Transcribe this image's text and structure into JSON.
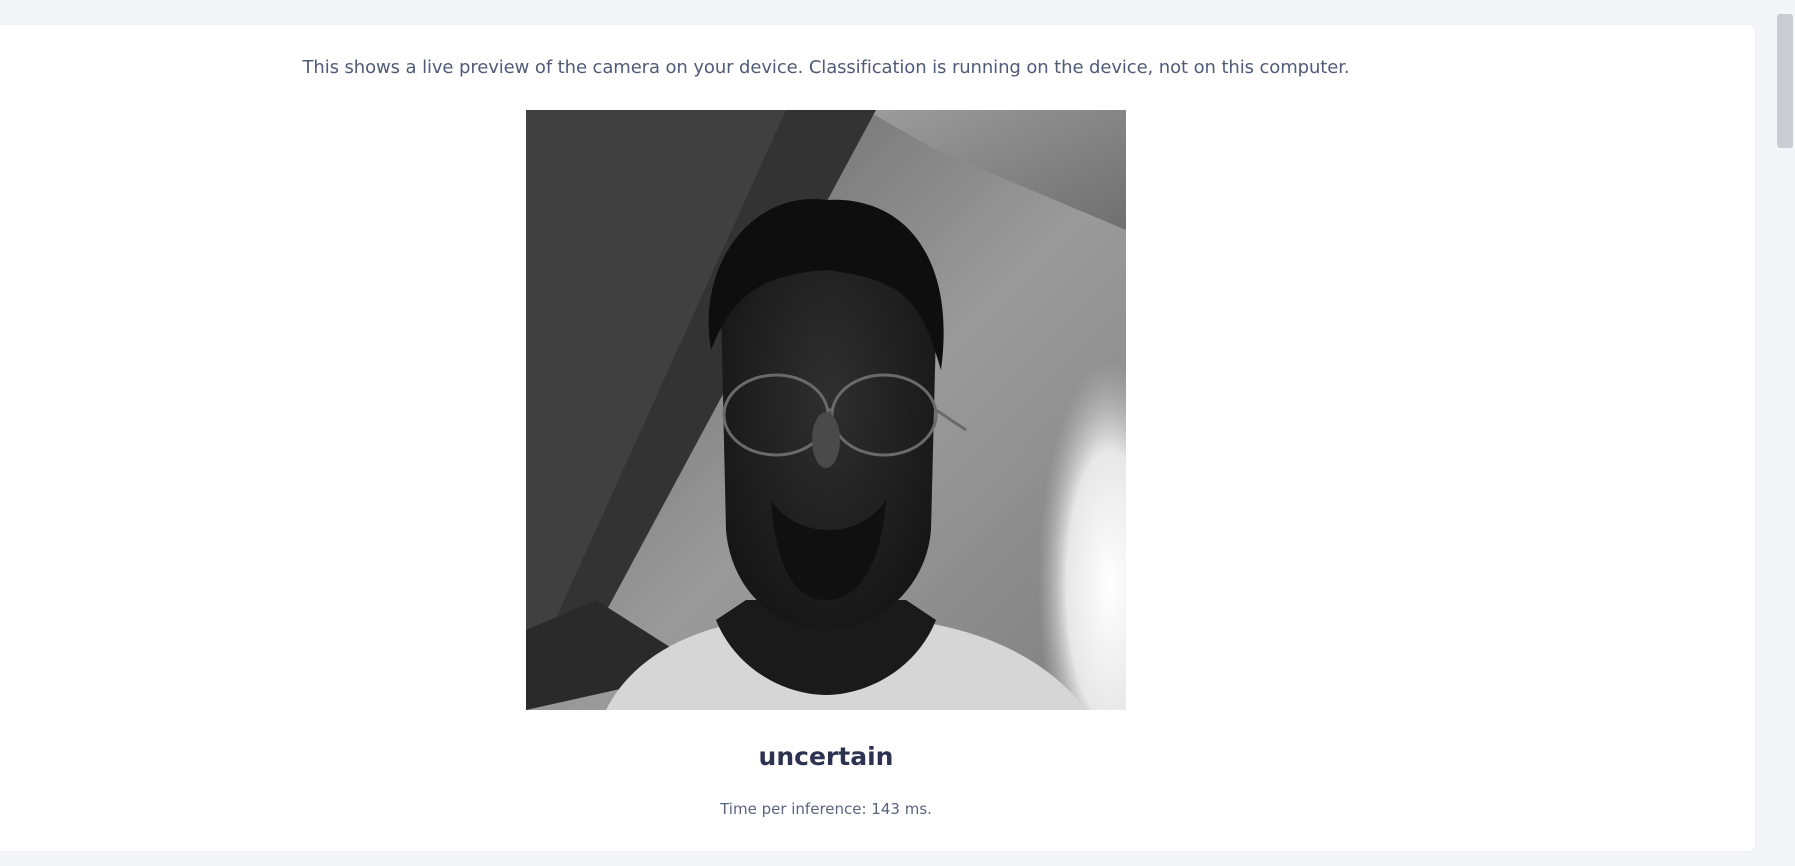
{
  "preview": {
    "description": "This shows a live preview of the camera on your device. Classification is running on the device, not on this computer.",
    "image_alt": "Live camera preview"
  },
  "classification": {
    "label": "uncertain",
    "time_text": "Time per inference: 143 ms."
  },
  "colors": {
    "background": "#f4f5f9",
    "card": "#ffffff",
    "text": "#505b78",
    "label": "#2d3250"
  }
}
